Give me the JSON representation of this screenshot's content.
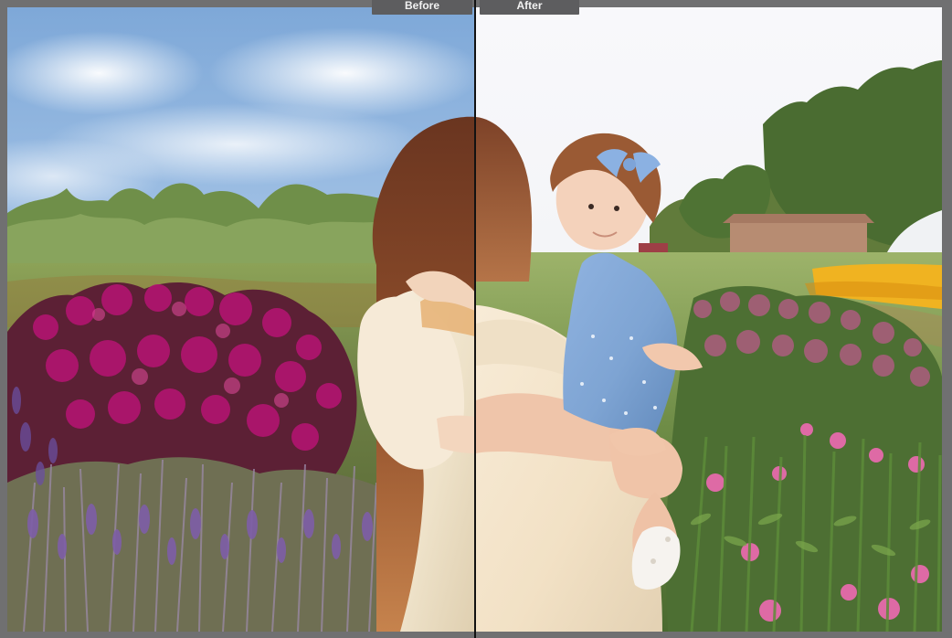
{
  "viewer": {
    "before_label": "Before",
    "after_label": "After"
  },
  "colors": {
    "background": "#707071",
    "label_background": "#5d5d5f",
    "divider": "#121212",
    "sky_before": "#8fb7dd",
    "sky_after": "#f6f7fa",
    "flowers_magenta": "#b21470",
    "flowers_pink": "#d9639b",
    "lavender": "#8868a8",
    "dress": "#f2e2c8",
    "romper": "#7ea4d3",
    "hair": "#8a4a2b"
  },
  "icons": {
    "photo_before": "photo-before-image",
    "photo_after": "photo-after-image"
  }
}
